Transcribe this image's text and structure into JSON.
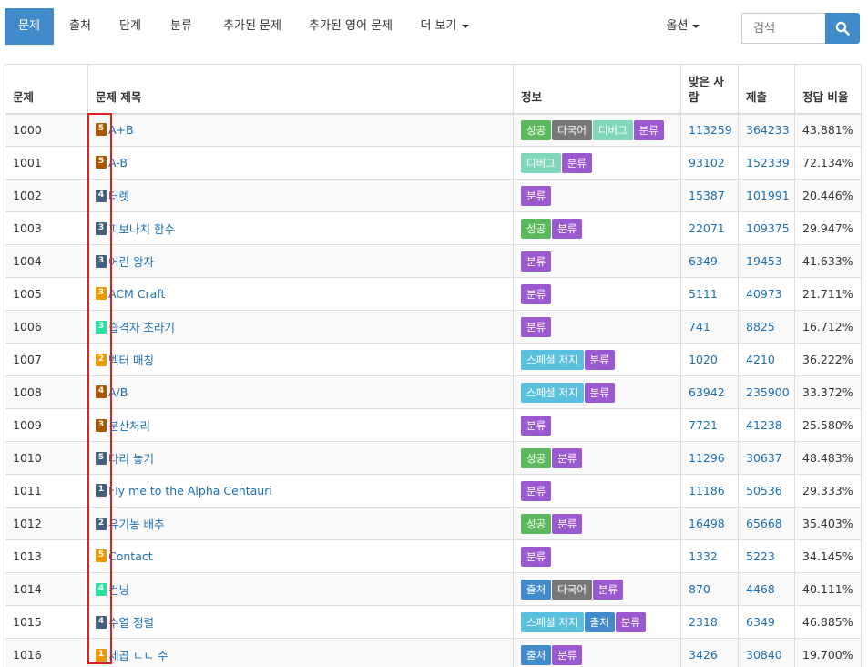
{
  "nav": {
    "items": [
      "문제",
      "출처",
      "단계",
      "분류",
      "추가된 문제",
      "추가된 영어 문제",
      "더 보기"
    ],
    "options_label": "옵션"
  },
  "search": {
    "placeholder": "검색"
  },
  "table": {
    "headers": [
      "문제",
      "문제 제목",
      "정보",
      "맞은 사람",
      "제출",
      "정답 비율"
    ],
    "rows": [
      {
        "id": "1000",
        "tier": "5",
        "tier_color": "#ad5600",
        "title": "A+B",
        "tags": [
          "성공",
          "다국어",
          "디버그",
          "분류"
        ],
        "solved": "113259",
        "submits": "364233",
        "ratio": "43.881%"
      },
      {
        "id": "1001",
        "tier": "5",
        "tier_color": "#ad5600",
        "title": "A-B",
        "tags": [
          "디버그",
          "분류"
        ],
        "solved": "93102",
        "submits": "152339",
        "ratio": "72.134%"
      },
      {
        "id": "1002",
        "tier": "4",
        "tier_color": "#435f7a",
        "title": "터렛",
        "tags": [
          "분류"
        ],
        "solved": "15387",
        "submits": "101991",
        "ratio": "20.446%"
      },
      {
        "id": "1003",
        "tier": "3",
        "tier_color": "#435f7a",
        "title": "피보나치 함수",
        "tags": [
          "성공",
          "분류"
        ],
        "solved": "22071",
        "submits": "109375",
        "ratio": "29.947%"
      },
      {
        "id": "1004",
        "tier": "3",
        "tier_color": "#435f7a",
        "title": "어린 왕자",
        "tags": [
          "분류"
        ],
        "solved": "6349",
        "submits": "19453",
        "ratio": "41.633%"
      },
      {
        "id": "1005",
        "tier": "3",
        "tier_color": "#ec9a00",
        "title": "ACM Craft",
        "tags": [
          "분류"
        ],
        "solved": "5111",
        "submits": "40973",
        "ratio": "21.711%"
      },
      {
        "id": "1006",
        "tier": "3",
        "tier_color": "#27e2a4",
        "title": "습격자 초라기",
        "tags": [
          "분류"
        ],
        "solved": "741",
        "submits": "8825",
        "ratio": "16.712%"
      },
      {
        "id": "1007",
        "tier": "2",
        "tier_color": "#ec9a00",
        "title": "벡터 매칭",
        "tags": [
          "스페셜 저지",
          "분류"
        ],
        "solved": "1020",
        "submits": "4210",
        "ratio": "36.222%"
      },
      {
        "id": "1008",
        "tier": "4",
        "tier_color": "#ad5600",
        "title": "A/B",
        "tags": [
          "스페셜 저지",
          "분류"
        ],
        "solved": "63942",
        "submits": "235900",
        "ratio": "33.372%"
      },
      {
        "id": "1009",
        "tier": "3",
        "tier_color": "#ad5600",
        "title": "분산처리",
        "tags": [
          "분류"
        ],
        "solved": "7721",
        "submits": "41238",
        "ratio": "25.580%"
      },
      {
        "id": "1010",
        "tier": "5",
        "tier_color": "#435f7a",
        "title": "다리 놓기",
        "tags": [
          "성공",
          "분류"
        ],
        "solved": "11296",
        "submits": "30637",
        "ratio": "48.483%"
      },
      {
        "id": "1011",
        "tier": "1",
        "tier_color": "#435f7a",
        "title": "Fly me to the Alpha Centauri",
        "tags": [
          "분류"
        ],
        "solved": "11186",
        "submits": "50536",
        "ratio": "29.333%"
      },
      {
        "id": "1012",
        "tier": "2",
        "tier_color": "#435f7a",
        "title": "유기농 배추",
        "tags": [
          "성공",
          "분류"
        ],
        "solved": "16498",
        "submits": "65668",
        "ratio": "35.403%"
      },
      {
        "id": "1013",
        "tier": "5",
        "tier_color": "#ec9a00",
        "title": "Contact",
        "tags": [
          "분류"
        ],
        "solved": "1332",
        "submits": "5223",
        "ratio": "34.145%"
      },
      {
        "id": "1014",
        "tier": "4",
        "tier_color": "#27e2a4",
        "title": "컨닝",
        "tags": [
          "출처",
          "다국어",
          "분류"
        ],
        "solved": "870",
        "submits": "4468",
        "ratio": "40.111%"
      },
      {
        "id": "1015",
        "tier": "4",
        "tier_color": "#435f7a",
        "title": "수열 정렬",
        "tags": [
          "스페셜 저지",
          "출처",
          "분류"
        ],
        "solved": "2318",
        "submits": "6349",
        "ratio": "46.885%"
      },
      {
        "id": "1016",
        "tier": "1",
        "tier_color": "#ec9a00",
        "title": "제곱 ㄴㄴ 수",
        "tags": [
          "출처",
          "분류"
        ],
        "solved": "3426",
        "submits": "30840",
        "ratio": "19.700%"
      }
    ]
  },
  "tag_colors": {
    "성공": "#5cb85c",
    "다국어": "#777777",
    "디버그": "#7fd6b8",
    "분류": "#9b59d0",
    "스페셜 저지": "#5bc0de",
    "출처": "#428bca"
  },
  "icons": {
    "search": "search-icon",
    "dropdown": "caret-down-icon",
    "tier": "tier-badge-icon"
  },
  "accent_color": "#428bca",
  "highlight_color": "#e02020"
}
